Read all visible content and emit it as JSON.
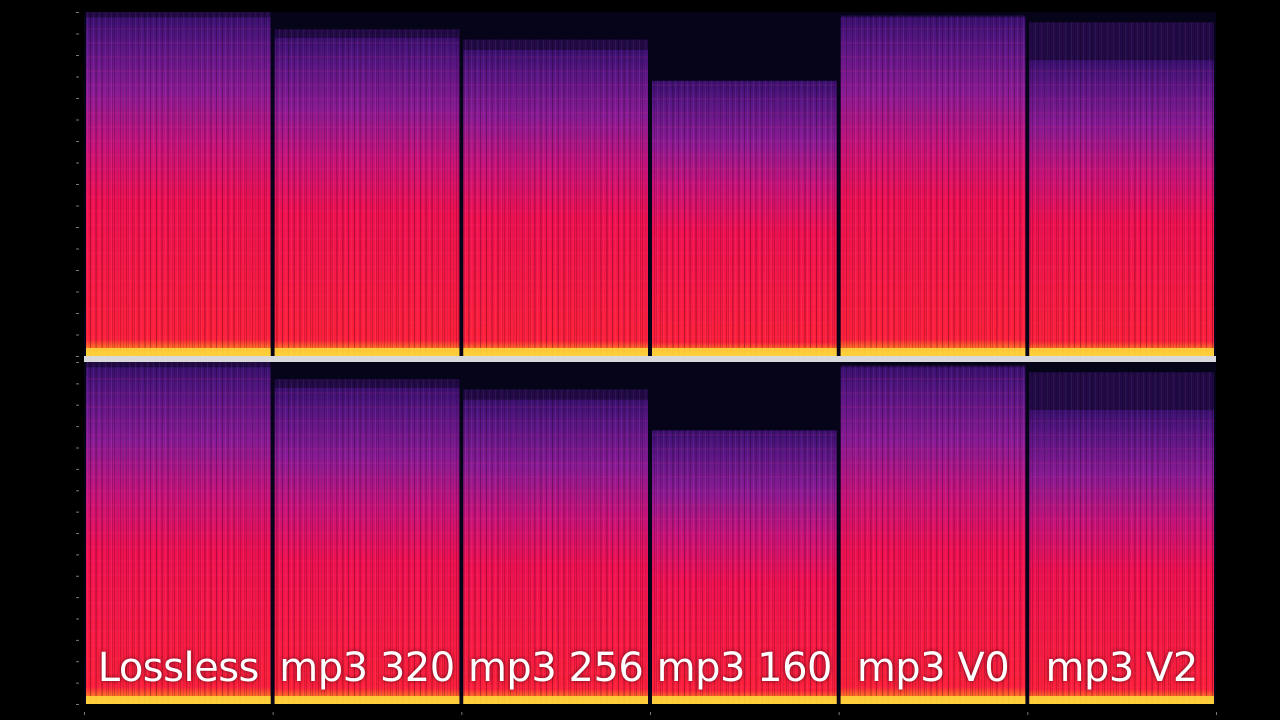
{
  "chart_data": {
    "type": "heatmap",
    "title": "",
    "xlabel": "",
    "ylabel": "",
    "channels": [
      "upper",
      "lower"
    ],
    "segments": [
      {
        "label": "Lossless",
        "cutoff_fraction": [
          0.985,
          0.985
        ],
        "tip_fraction": [
          1.0,
          1.0
        ]
      },
      {
        "label": "mp3 320",
        "cutoff_fraction": [
          0.925,
          0.925
        ],
        "tip_fraction": [
          0.95,
          0.95
        ]
      },
      {
        "label": "mp3 256",
        "cutoff_fraction": [
          0.89,
          0.89
        ],
        "tip_fraction": [
          0.92,
          0.92
        ]
      },
      {
        "label": "mp3 160",
        "cutoff_fraction": [
          0.8,
          0.8
        ],
        "tip_fraction": [
          0.8,
          0.8
        ]
      },
      {
        "label": "mp3 V0",
        "cutoff_fraction": [
          0.985,
          0.985
        ],
        "tip_fraction": [
          0.99,
          0.99
        ]
      },
      {
        "label": "mp3 V2",
        "cutoff_fraction": [
          0.86,
          0.86
        ],
        "tip_fraction": [
          0.97,
          0.97
        ]
      }
    ],
    "colors": {
      "background": "#050418",
      "base": "#ff0a3c",
      "mid": "#e8106a",
      "upper": "#8a1a8f",
      "top": "#4a1278",
      "bottom_hot": "#ffd23c",
      "divider": "#000000"
    }
  }
}
